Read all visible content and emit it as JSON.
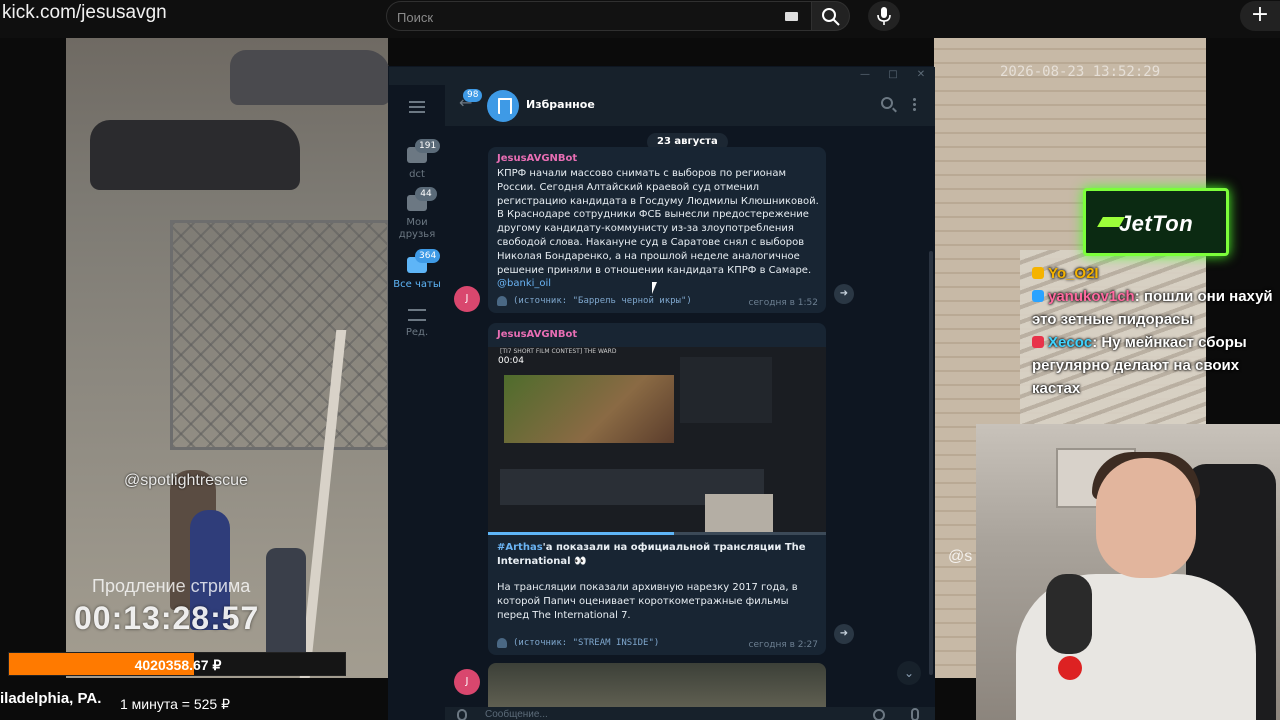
{
  "browser": {
    "url": "kick.com/jesusavgn",
    "search_placeholder": "Поиск",
    "plus_label": "+"
  },
  "stream": {
    "watermark_date": "2026-08-23 13:52:29",
    "handle": "@spotlightrescue",
    "handle_right": "@s",
    "extension_label": "Продление стрима",
    "timer": "00:13:28:57",
    "donation_amount": "4020358.67 ₽",
    "donation_progress": 0.55,
    "location": "iladelphia, PA.",
    "rate": "1 минута = 525 ₽"
  },
  "sponsor": {
    "logo": "JetTon"
  },
  "chat_overlay": [
    {
      "user": "Yo_O2I",
      "badge_color": "#f5b300",
      "text": ""
    },
    {
      "user": "yanukov1ch",
      "badge_color": "#2aa3ff",
      "text": ": пошли они нахуй это зетные пидорасы"
    },
    {
      "user": "Xecoc",
      "badge_color": "#e8334a",
      "text": ": Ну мейнкаст сборы регулярно делают на своих кастах"
    }
  ],
  "telegram": {
    "window_buttons": [
      "—",
      "□",
      "✕"
    ],
    "folders": [
      {
        "label": "dct",
        "badge": "191",
        "active": false
      },
      {
        "label": "Мои друзья",
        "badge": "44",
        "active": false
      },
      {
        "label": "Все чаты",
        "badge": "364",
        "active": true
      },
      {
        "label": "Ред.",
        "badge": "",
        "active": false
      }
    ],
    "back_badge": "98",
    "chat_title": "Избранное",
    "date_separator": "23 августа",
    "messages": [
      {
        "sender": "JesusAVGNBot",
        "text": "КПРФ начали массово снимать с выборов по регионам России. Сегодня Алтайский краевой суд отменил регистрацию кандидата в Госдуму Людмилы Клюшниковой. В Краснодаре сотрудники ФСБ вынесли предостережение другому кандидату-коммунисту из-за злоупотребления свободой слова. Накануне суд в Саратове снял с выборов Николая Бондаренко, а на прошлой неделе аналогичное решение приняли в отношении кандидата КПРФ в Самаре.",
        "link": "@banki_oil",
        "source": "(источник: \"Баррель черной икры\")",
        "time": "сегодня в 1:52",
        "avatar_letter": "J"
      },
      {
        "sender": "JesusAVGNBot",
        "video_title": "[TI7 SHORT FILM CONTEST] THE WARD",
        "video_time": "00:04",
        "video_progress": 0.55,
        "text_hashtag": "#Arthas",
        "text_head": "'а показали на официальной трансляции The International 👀",
        "text_body": "На трансляции показали архивную нарезку 2017 года, в которой Папич оценивает короткометражные фильмы перед The International 7.",
        "source": "(источник: \"STREAM INSIDE\")",
        "time": "сегодня в 2:27",
        "avatar_letter": "J"
      }
    ],
    "compose_placeholder": "Сообщение..."
  },
  "colors": {
    "accent": "#5eb5f7",
    "sender": "#e86eb4",
    "donation": "#ff7a00",
    "jetton_border": "#7cff3a"
  }
}
